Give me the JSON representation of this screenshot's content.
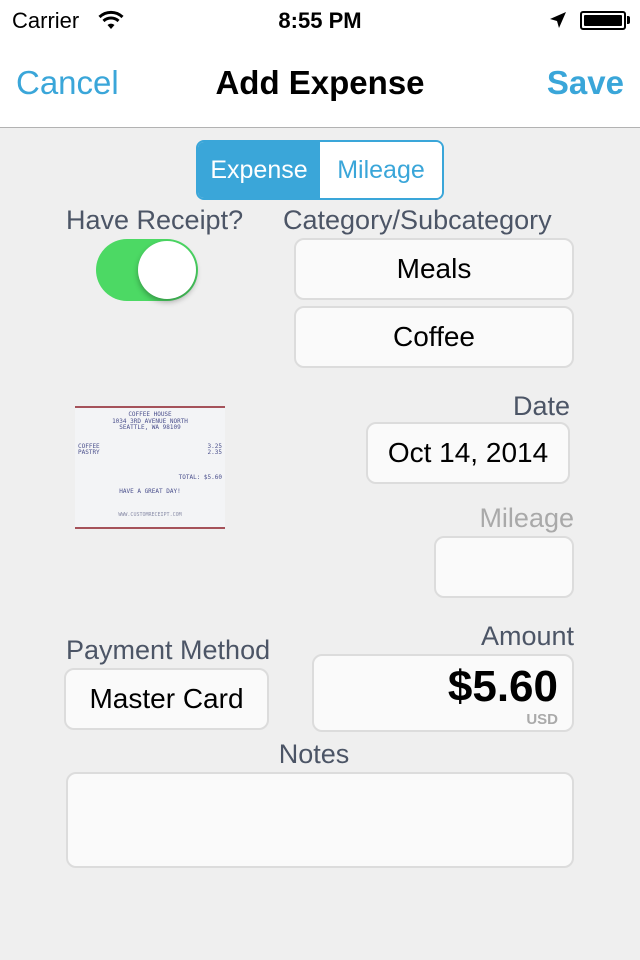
{
  "status_bar": {
    "carrier": "Carrier",
    "time": "8:55 PM",
    "icons": [
      "wifi-icon",
      "location-arrow-icon",
      "battery-icon"
    ],
    "battery_level": 1.0
  },
  "nav": {
    "cancel_label": "Cancel",
    "title": "Add Expense",
    "save_label": "Save"
  },
  "colors": {
    "accent": "#3aa6d9",
    "toggle_on": "#4cd964",
    "label": "#4c5566",
    "muted_label": "#a9a9a9"
  },
  "segments": {
    "items": [
      {
        "label": "Expense",
        "selected": true
      },
      {
        "label": "Mileage",
        "selected": false
      }
    ]
  },
  "receipt_section": {
    "label": "Have Receipt?",
    "toggle_on": true
  },
  "receipt_image": {
    "store": "COFFEE HOUSE",
    "address1": "1034 3RD AVENUE NORTH",
    "address2": "SEATTLE, WA 98109",
    "items": [
      {
        "name": "COFFEE",
        "price": "3.25"
      },
      {
        "name": "PASTRY",
        "price": "2.35"
      }
    ],
    "total": "TOTAL: $5.60",
    "greeting": "HAVE A GREAT DAY!",
    "footer": "WWW.CUSTOMRECEIPT.COM"
  },
  "category": {
    "label": "Category/Subcategory",
    "category_value": "Meals",
    "subcategory_value": "Coffee"
  },
  "date": {
    "label": "Date",
    "value": "Oct 14, 2014"
  },
  "mileage": {
    "label": "Mileage",
    "value": ""
  },
  "payment": {
    "label": "Payment Method",
    "value": "Master Card"
  },
  "amount": {
    "label": "Amount",
    "value": "$5.60",
    "currency": "USD"
  },
  "notes": {
    "label": "Notes",
    "value": ""
  }
}
